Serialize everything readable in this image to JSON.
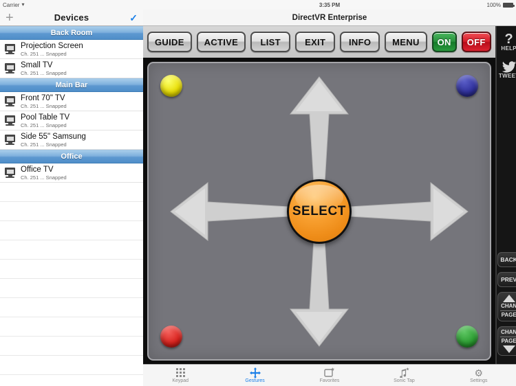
{
  "status": {
    "carrier": "Carrier",
    "wifi_icon": "wifi-icon",
    "time": "3:35 PM",
    "battery_pct": "100%",
    "battery_icon": "battery-icon"
  },
  "sidebar": {
    "add_label": "+",
    "title": "Devices",
    "done_icon": "checkmark-icon",
    "sections": [
      {
        "name": "Back Room",
        "devices": [
          {
            "name": "Projection Screen",
            "sub": "Ch. 251 ... Snapped",
            "icon": "tv-icon"
          },
          {
            "name": "Small TV",
            "sub": "Ch. 251 ... Snapped",
            "icon": "tv-icon"
          }
        ]
      },
      {
        "name": "Main Bar",
        "devices": [
          {
            "name": "Front 70\" TV",
            "sub": "Ch. 251 ... Snapped",
            "icon": "tv-icon"
          },
          {
            "name": "Pool Table TV",
            "sub": "Ch. 251 ... Snapped",
            "icon": "tv-icon"
          },
          {
            "name": "Side 55\" Samsung",
            "sub": "Ch. 251 ... Snapped",
            "icon": "tv-icon"
          }
        ]
      },
      {
        "name": "Office",
        "devices": [
          {
            "name": "Office TV",
            "sub": "Ch. 251 ... Snapped",
            "icon": "tv-icon"
          }
        ]
      }
    ]
  },
  "app": {
    "title": "DirectVR Enterprise"
  },
  "toolbar": {
    "buttons": [
      {
        "label": "GUIDE",
        "style": "gray"
      },
      {
        "label": "ACTIVE",
        "style": "gray"
      },
      {
        "label": "LIST",
        "style": "gray"
      },
      {
        "label": "EXIT",
        "style": "gray"
      },
      {
        "label": "INFO",
        "style": "gray"
      },
      {
        "label": "MENU",
        "style": "gray"
      },
      {
        "label": "ON",
        "style": "green"
      },
      {
        "label": "OFF",
        "style": "red"
      }
    ]
  },
  "gesture_pad": {
    "select_label": "SELECT",
    "corner_buttons": [
      {
        "name": "yellow-button",
        "color": "#e8dc00",
        "position": "top-left"
      },
      {
        "name": "blue-button",
        "color": "#2e2f9a",
        "position": "top-right"
      },
      {
        "name": "red-button",
        "color": "#d8211c",
        "position": "bottom-left"
      },
      {
        "name": "green-button",
        "color": "#2a9b30",
        "position": "bottom-right"
      }
    ],
    "arrows": [
      "up",
      "down",
      "left",
      "right"
    ]
  },
  "rail": {
    "help_label": "HELP",
    "help_icon": "question-mark-icon",
    "tweet_label": "TWEET",
    "tweet_icon": "twitter-bird-icon",
    "back_label": "BACK",
    "prev_label": "PREV",
    "chan_label": "CHAN",
    "page_label": "PAGE",
    "up_icon": "triangle-up-icon",
    "down_icon": "triangle-down-icon"
  },
  "tabbar": {
    "tabs": [
      {
        "label": "Keypad",
        "icon": "keypad-icon",
        "active": false
      },
      {
        "label": "Gestures",
        "icon": "gestures-icon",
        "active": true
      },
      {
        "label": "Favorites",
        "icon": "favorites-icon",
        "active": false
      },
      {
        "label": "Sonic Tap",
        "icon": "sonic-tap-icon",
        "active": false
      },
      {
        "label": "Settings",
        "icon": "settings-gear-icon",
        "active": false
      }
    ]
  },
  "colors": {
    "accent_blue": "#1a7fe8",
    "select_orange": "#f79e2e",
    "pad_gray": "#75757b"
  }
}
